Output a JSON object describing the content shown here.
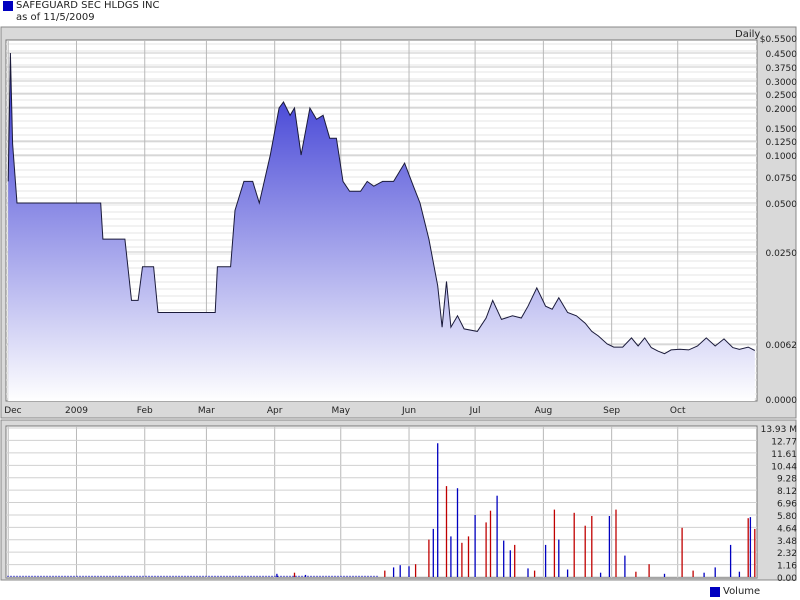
{
  "header": {
    "title": "SAFEGUARD SEC HLDGS INC",
    "subtitle": "as of 11/5/2009",
    "period": "Daily"
  },
  "colors": {
    "brand": "#0000c0",
    "price_line": "#1a1a3a",
    "fill_top": "#3b3bd6",
    "fill_bottom": "#ffffff",
    "panel_bg": "#d9d9d9",
    "grid": "#c0c0c0",
    "volume_up": "#0000c0",
    "volume_down": "#c00000"
  },
  "chart_data": [
    {
      "type": "area",
      "title": "SAFEGUARD SEC HLDGS INC",
      "y_scale": "log",
      "y_ticks": [
        "0.5500",
        "0.4500",
        "0.3750",
        "0.3000",
        "0.2500",
        "0.2000",
        "0.1500",
        "0.1250",
        "0.1000",
        "0.0750",
        "0.0500",
        "0.0250",
        "0.0062",
        "0.0000"
      ],
      "x_ticks": [
        "Dec",
        "2009",
        "Feb",
        "Mar",
        "Apr",
        "May",
        "Jun",
        "Jul",
        "Aug",
        "Sep",
        "Oct"
      ],
      "series": [
        {
          "values": [
            [
              "2008-12-01",
              0.07
            ],
            [
              "2008-12-02",
              0.45
            ],
            [
              "2008-12-03",
              0.12
            ],
            [
              "2008-12-05",
              0.05
            ],
            [
              "2008-12-15",
              0.05
            ],
            [
              "2009-01-12",
              0.05
            ],
            [
              "2009-01-13",
              0.03
            ],
            [
              "2009-01-23",
              0.03
            ],
            [
              "2009-01-26",
              0.012
            ],
            [
              "2009-01-29",
              0.012
            ],
            [
              "2009-01-31",
              0.02
            ],
            [
              "2009-02-05",
              0.02
            ],
            [
              "2009-02-07",
              0.01
            ],
            [
              "2009-02-20",
              0.01
            ],
            [
              "2009-03-05",
              0.01
            ],
            [
              "2009-03-06",
              0.02
            ],
            [
              "2009-03-12",
              0.02
            ],
            [
              "2009-03-14",
              0.045
            ],
            [
              "2009-03-18",
              0.07
            ],
            [
              "2009-03-22",
              0.07
            ],
            [
              "2009-03-25",
              0.05
            ],
            [
              "2009-03-30",
              0.1
            ],
            [
              "2009-04-03",
              0.2
            ],
            [
              "2009-04-05",
              0.22
            ],
            [
              "2009-04-08",
              0.18
            ],
            [
              "2009-04-10",
              0.2
            ],
            [
              "2009-04-13",
              0.1
            ],
            [
              "2009-04-17",
              0.2
            ],
            [
              "2009-04-20",
              0.17
            ],
            [
              "2009-04-23",
              0.18
            ],
            [
              "2009-04-26",
              0.13
            ],
            [
              "2009-04-29",
              0.13
            ],
            [
              "2009-05-02",
              0.07
            ],
            [
              "2009-05-05",
              0.06
            ],
            [
              "2009-05-10",
              0.06
            ],
            [
              "2009-05-13",
              0.07
            ],
            [
              "2009-05-16",
              0.065
            ],
            [
              "2009-05-20",
              0.07
            ],
            [
              "2009-05-25",
              0.07
            ],
            [
              "2009-05-30",
              0.09
            ],
            [
              "2009-06-03",
              0.065
            ],
            [
              "2009-06-06",
              0.05
            ],
            [
              "2009-06-10",
              0.03
            ],
            [
              "2009-06-14",
              0.015
            ],
            [
              "2009-06-16",
              0.008
            ],
            [
              "2009-06-18",
              0.016
            ],
            [
              "2009-06-20",
              0.008
            ],
            [
              "2009-06-23",
              0.0095
            ],
            [
              "2009-06-26",
              0.0078
            ],
            [
              "2009-07-02",
              0.0075
            ],
            [
              "2009-07-06",
              0.0092
            ],
            [
              "2009-07-09",
              0.012
            ],
            [
              "2009-07-13",
              0.009
            ],
            [
              "2009-07-18",
              0.0095
            ],
            [
              "2009-07-22",
              0.0092
            ],
            [
              "2009-07-25",
              0.011
            ],
            [
              "2009-07-29",
              0.0145
            ],
            [
              "2009-08-02",
              0.011
            ],
            [
              "2009-08-05",
              0.0105
            ],
            [
              "2009-08-08",
              0.0125
            ],
            [
              "2009-08-12",
              0.01
            ],
            [
              "2009-08-16",
              0.0095
            ],
            [
              "2009-08-20",
              0.0085
            ],
            [
              "2009-08-23",
              0.0075
            ],
            [
              "2009-08-26",
              0.007
            ],
            [
              "2009-08-30",
              0.0062
            ],
            [
              "2009-09-02",
              0.0056
            ],
            [
              "2009-09-06",
              0.0056
            ],
            [
              "2009-09-10",
              0.0068
            ],
            [
              "2009-09-13",
              0.0058
            ],
            [
              "2009-09-16",
              0.0068
            ],
            [
              "2009-09-19",
              0.0055
            ],
            [
              "2009-09-22",
              0.0049
            ],
            [
              "2009-09-25",
              0.0045
            ],
            [
              "2009-09-28",
              0.0051
            ],
            [
              "2009-10-02",
              0.0052
            ],
            [
              "2009-10-06",
              0.0051
            ],
            [
              "2009-10-10",
              0.0058
            ],
            [
              "2009-10-14",
              0.0068
            ],
            [
              "2009-10-18",
              0.0058
            ],
            [
              "2009-10-22",
              0.0067
            ],
            [
              "2009-10-26",
              0.0055
            ],
            [
              "2009-10-29",
              0.0052
            ],
            [
              "2009-11-02",
              0.0056
            ],
            [
              "2009-11-05",
              0.005
            ]
          ]
        }
      ]
    },
    {
      "type": "bar",
      "y_ticks": [
        "13.93 M",
        "12.77",
        "11.61",
        "10.44",
        "9.28",
        "8.12",
        "6.96",
        "5.80",
        "4.64",
        "3.48",
        "2.32",
        "1.16",
        "0.00"
      ],
      "ylim": [
        0,
        13.93
      ],
      "series": [
        {
          "name": "Volume",
          "values": [
            [
              "2009-06-14",
              12.5,
              "up"
            ],
            [
              "2009-06-18",
              8.5,
              "down"
            ],
            [
              "2009-06-23",
              8.3,
              "up"
            ],
            [
              "2009-07-01",
              5.8,
              "up"
            ],
            [
              "2009-07-06",
              5.1,
              "down"
            ],
            [
              "2009-07-08",
              6.2,
              "down"
            ],
            [
              "2009-07-11",
              7.6,
              "up"
            ],
            [
              "2009-08-06",
              6.3,
              "down"
            ],
            [
              "2009-08-15",
              6.0,
              "down"
            ],
            [
              "2009-08-20",
              4.8,
              "down"
            ],
            [
              "2009-08-23",
              5.7,
              "down"
            ],
            [
              "2009-08-31",
              5.7,
              "up"
            ],
            [
              "2009-09-03",
              6.3,
              "down"
            ],
            [
              "2009-10-03",
              4.6,
              "down"
            ],
            [
              "2009-10-25",
              3.0,
              "up"
            ],
            [
              "2009-11-02",
              5.5,
              "down"
            ],
            [
              "2009-11-03",
              5.6,
              "up"
            ],
            [
              "2009-11-05",
              4.5,
              "down"
            ],
            [
              "2009-06-10",
              3.5,
              "down"
            ],
            [
              "2009-06-12",
              4.5,
              "up"
            ],
            [
              "2009-06-20",
              3.8,
              "up"
            ],
            [
              "2009-06-25",
              3.2,
              "down"
            ],
            [
              "2009-06-28",
              3.8,
              "down"
            ],
            [
              "2009-07-14",
              3.4,
              "up"
            ],
            [
              "2009-07-17",
              2.5,
              "up"
            ],
            [
              "2009-07-19",
              3.0,
              "down"
            ],
            [
              "2009-08-02",
              3.0,
              "up"
            ],
            [
              "2009-08-08",
              3.5,
              "up"
            ],
            [
              "2009-09-07",
              2.0,
              "up"
            ],
            [
              "2009-09-18",
              1.2,
              "down"
            ],
            [
              "2009-10-18",
              0.9,
              "up"
            ],
            [
              "2009-06-01",
              1.0,
              "up"
            ],
            [
              "2009-06-04",
              1.2,
              "down"
            ],
            [
              "2009-05-25",
              0.9,
              "up"
            ],
            [
              "2009-05-28",
              1.1,
              "up"
            ],
            [
              "2009-05-21",
              0.6,
              "down"
            ],
            [
              "2009-04-02",
              0.3,
              "up"
            ],
            [
              "2009-04-10",
              0.4,
              "down"
            ],
            [
              "2009-04-15",
              0.2,
              "up"
            ],
            [
              "2009-07-25",
              0.8,
              "up"
            ],
            [
              "2009-07-28",
              0.6,
              "down"
            ],
            [
              "2009-08-12",
              0.7,
              "up"
            ],
            [
              "2009-08-27",
              0.4,
              "up"
            ],
            [
              "2009-09-12",
              0.5,
              "down"
            ],
            [
              "2009-09-25",
              0.3,
              "up"
            ],
            [
              "2009-10-08",
              0.6,
              "down"
            ],
            [
              "2009-10-13",
              0.4,
              "up"
            ],
            [
              "2009-10-29",
              0.5,
              "up"
            ]
          ]
        }
      ]
    }
  ]
}
